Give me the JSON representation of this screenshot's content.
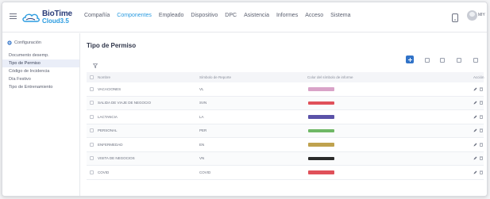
{
  "app": {
    "logo_line1": "BioTime",
    "logo_line2": "Cloud3.5"
  },
  "nav": [
    {
      "label": "Compañía",
      "active": false
    },
    {
      "label": "Componentes",
      "active": true
    },
    {
      "label": "Empleado",
      "active": false
    },
    {
      "label": "Dispositivo",
      "active": false
    },
    {
      "label": "DPC",
      "active": false
    },
    {
      "label": "Asistencia",
      "active": false
    },
    {
      "label": "Informes",
      "active": false
    },
    {
      "label": "Acceso",
      "active": false
    },
    {
      "label": "Sistema",
      "active": false
    }
  ],
  "user": {
    "label": "MIY"
  },
  "sidebar": {
    "header": "Configuración",
    "items": [
      {
        "label": "Documento desemp.",
        "active": false
      },
      {
        "label": "Tipo de Permiso",
        "active": true
      },
      {
        "label": "Código de Incidencia",
        "active": false
      },
      {
        "label": "Día Festivo",
        "active": false
      },
      {
        "label": "Tipo de Entrenamiento",
        "active": false
      }
    ]
  },
  "page": {
    "title": "Tipo de Permiso"
  },
  "table": {
    "headers": {
      "name": "Nombre",
      "abbr": "Símbolo de Reporte",
      "color": "Color del símbolo de informe",
      "actions": "Acción"
    },
    "rows": [
      {
        "name": "VACACIONES",
        "abbr": "VL",
        "color": "#d9a3c8"
      },
      {
        "name": "SALIDA DE VIAJE DE NEGOCIO",
        "abbr": "SVN",
        "color": "#e0515a"
      },
      {
        "name": "LACTANCIA",
        "abbr": "LA",
        "color": "#5b52a8"
      },
      {
        "name": "PERSONAL",
        "abbr": "PER",
        "color": "#6fb866"
      },
      {
        "name": "ENFERMEDAD",
        "abbr": "EN",
        "color": "#bfa24e"
      },
      {
        "name": "VISITA DE NEGOCIOS",
        "abbr": "VN",
        "color": "#2b2b2b"
      },
      {
        "name": "COVID",
        "abbr": "COVID",
        "color": "#e0515a"
      }
    ]
  }
}
